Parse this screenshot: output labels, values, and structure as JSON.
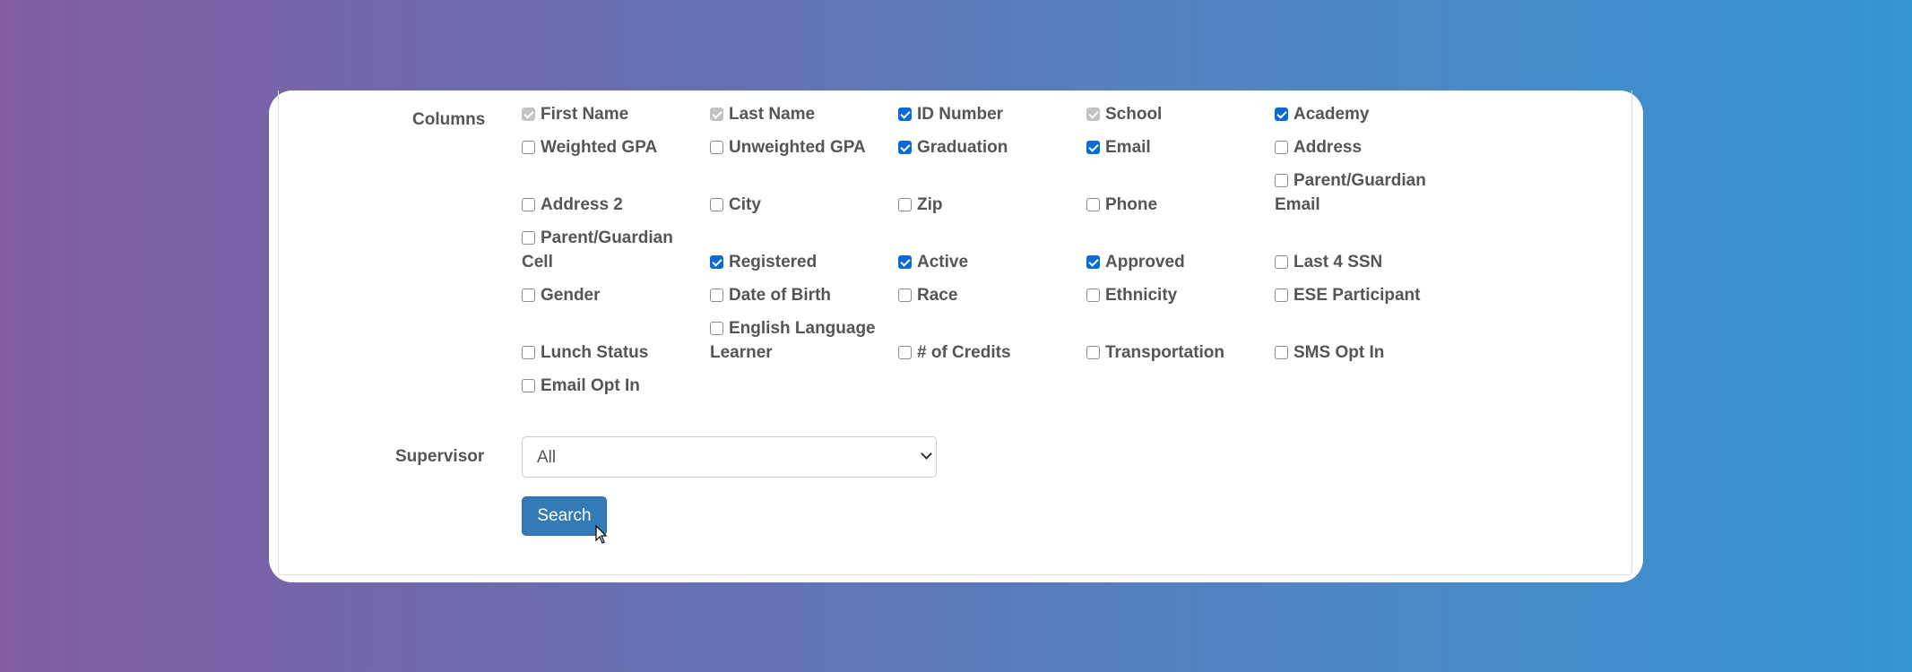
{
  "form": {
    "columns_label": "Columns",
    "columns": [
      {
        "label": "First Name",
        "state": "disabled"
      },
      {
        "label": "Last Name",
        "state": "disabled"
      },
      {
        "label": "ID Number",
        "state": "checked"
      },
      {
        "label": "School",
        "state": "disabled"
      },
      {
        "label": "Academy",
        "state": "checked"
      },
      {
        "label": "Weighted GPA",
        "state": "unchecked"
      },
      {
        "label": "Unweighted GPA",
        "state": "unchecked"
      },
      {
        "label": "Graduation",
        "state": "checked"
      },
      {
        "label": "Email",
        "state": "checked"
      },
      {
        "label": "Address",
        "state": "unchecked"
      },
      {
        "label": "Address 2",
        "state": "unchecked"
      },
      {
        "label": "City",
        "state": "unchecked"
      },
      {
        "label": "Zip",
        "state": "unchecked"
      },
      {
        "label": "Phone",
        "state": "unchecked"
      },
      {
        "label": "Parent/Guardian Email",
        "state": "unchecked"
      },
      {
        "label": "Parent/Guardian Cell",
        "state": "unchecked"
      },
      {
        "label": "Registered",
        "state": "checked"
      },
      {
        "label": "Active",
        "state": "checked"
      },
      {
        "label": "Approved",
        "state": "checked"
      },
      {
        "label": "Last 4 SSN",
        "state": "unchecked"
      },
      {
        "label": "Gender",
        "state": "unchecked"
      },
      {
        "label": "Date of Birth",
        "state": "unchecked"
      },
      {
        "label": "Race",
        "state": "unchecked"
      },
      {
        "label": "Ethnicity",
        "state": "unchecked"
      },
      {
        "label": "ESE Participant",
        "state": "unchecked"
      },
      {
        "label": "Lunch Status",
        "state": "unchecked"
      },
      {
        "label": "English Language Learner",
        "state": "unchecked"
      },
      {
        "label": "# of Credits",
        "state": "unchecked"
      },
      {
        "label": "Transportation",
        "state": "unchecked"
      },
      {
        "label": "SMS Opt In",
        "state": "unchecked"
      },
      {
        "label": "Email Opt In",
        "state": "unchecked"
      }
    ],
    "supervisor_label": "Supervisor",
    "supervisor_value": "All",
    "search_label": "Search"
  },
  "colors": {
    "accent": "#337ab7",
    "checkbox_checked": "#0a6bd6"
  }
}
